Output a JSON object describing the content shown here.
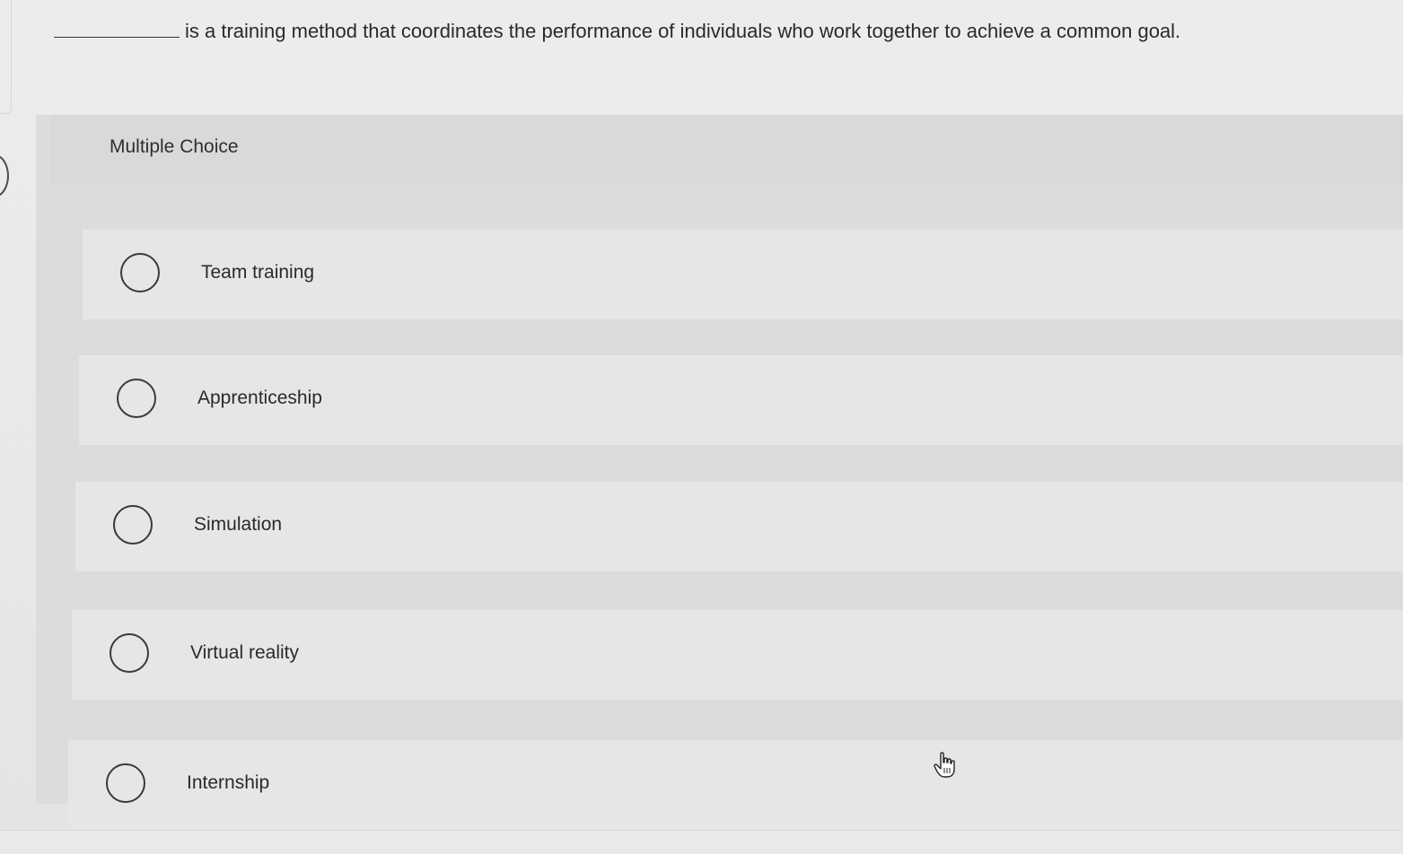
{
  "question": {
    "text": "is a training method that coordinates the performance of individuals who work together to achieve a common goal."
  },
  "multiple_choice": {
    "title": "Multiple Choice",
    "options": [
      {
        "label": "Team training"
      },
      {
        "label": "Apprenticeship"
      },
      {
        "label": "Simulation"
      },
      {
        "label": "Virtual reality"
      },
      {
        "label": "Internship"
      }
    ]
  },
  "icons": {
    "cursor": "hand-pointer-icon",
    "radio": "radio-circle-icon"
  },
  "colors": {
    "background": "#eaeaea",
    "panel": "#dcdcdc",
    "option_row": "#e6e6e6",
    "text": "#2a2a2a"
  }
}
